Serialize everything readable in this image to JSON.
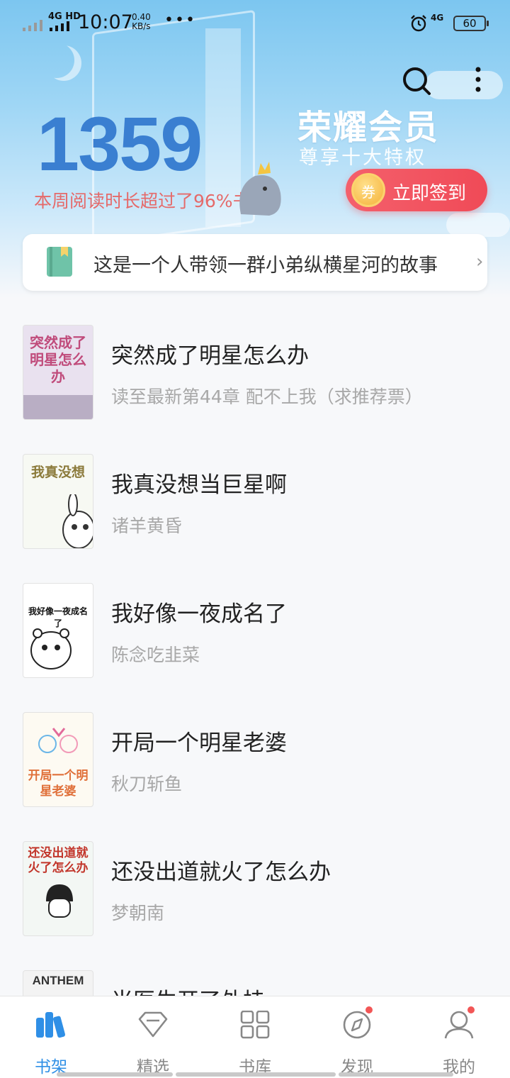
{
  "status_bar": {
    "network": "4G HD",
    "time": "10:07",
    "speed_value": "0.40",
    "speed_unit": "KB/s",
    "dots": "•••",
    "network2": "4G",
    "battery": "60"
  },
  "header": {
    "reading_minutes": "1359",
    "reading_sub": "本周阅读时长超过了96%书友",
    "vip_title": "荣耀会员",
    "vip_sub": "尊享十大特权",
    "signin_icon": "券",
    "signin_label": "立即签到",
    "icons": [
      "search-icon",
      "more-vertical-icon"
    ]
  },
  "notice": {
    "text": "这是一个人带领一群小弟纵横星河的故事",
    "arrow": "›"
  },
  "books": [
    {
      "title": "突然成了明星怎么办",
      "sub": "读至最新第44章 配不上我（求推荐票）",
      "cover_text": "突然成了明星怎么办",
      "cover_color": "#e9e1ef"
    },
    {
      "title": "我真没想当巨星啊",
      "sub": "诸羊黄昏",
      "cover_text": "我真没想",
      "cover_color": "#f7f9f3"
    },
    {
      "title": "我好像一夜成名了",
      "sub": "陈念吃韭菜",
      "cover_text": "我好像一夜成名了",
      "cover_color": "#ffffff"
    },
    {
      "title": "开局一个明星老婆",
      "sub": "秋刀斩鱼",
      "cover_text": "开局一个明星老婆",
      "cover_color": "#fdfaf2"
    },
    {
      "title": "还没出道就火了怎么办",
      "sub": "梦朝南",
      "cover_text": "还没出道就火了怎么办",
      "cover_color": "#f3f7f4"
    },
    {
      "title": "当医生开了外挂",
      "sub": "",
      "cover_text": "ANTHEM",
      "cover_color": "#f3f3f3"
    }
  ],
  "tabs": [
    {
      "label": "书架",
      "icon": "bookshelf-icon",
      "active": true,
      "badge": false
    },
    {
      "label": "精选",
      "icon": "diamond-icon",
      "active": false,
      "badge": false
    },
    {
      "label": "书库",
      "icon": "grid-icon",
      "active": false,
      "badge": false
    },
    {
      "label": "发现",
      "icon": "compass-icon",
      "active": false,
      "badge": true
    },
    {
      "label": "我的",
      "icon": "user-icon",
      "active": false,
      "badge": true
    }
  ],
  "colors": {
    "accent": "#2f8fe6",
    "number": "#3a7fd1",
    "signin": "#f04a57",
    "badge": "#f25656"
  }
}
